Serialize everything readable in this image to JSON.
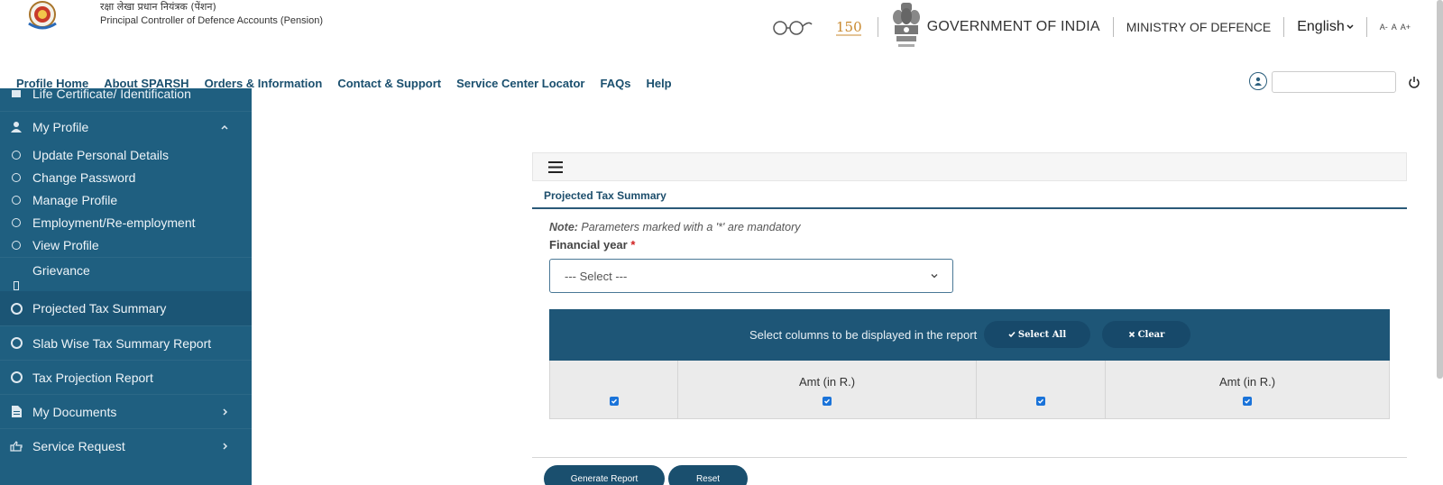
{
  "header": {
    "org_hindi": "रक्षा लेखा प्रधान नियंत्रक (पेंशन)",
    "org_name": "Principal Controller of Defence Accounts (Pension)",
    "gov": "GOVERNMENT OF INDIA",
    "ministry": "MINISTRY OF DEFENCE",
    "language": "English",
    "font_sizes": [
      "A-",
      "A",
      "A+"
    ]
  },
  "nav": {
    "items": [
      "Profile Home",
      "About SPARSH",
      "Orders & Information",
      "Contact & Support",
      "Service Center Locator",
      "FAQs",
      "Help"
    ]
  },
  "sidebar": {
    "life_certificate": "Life Certificate/ Identification",
    "my_profile": "My Profile",
    "profile_items": [
      "Update Personal Details",
      "Change Password",
      "Manage Profile",
      "Employment/Re-employment",
      "View Profile"
    ],
    "grievance": "Grievance",
    "projected_tax": "Projected Tax Summary",
    "slab_wise": "Slab Wise Tax Summary Report",
    "tax_projection": "Tax Projection Report",
    "my_documents": "My Documents",
    "service_request": "Service Request"
  },
  "main": {
    "title": "Projected Tax Summary",
    "note_label": "Note:",
    "note_text": " Parameters marked with a '*' are mandatory",
    "fy_label": "Financial year",
    "fy_required": "*",
    "fy_select": "--- Select ---",
    "columns_prompt": "Select columns to be displayed in the report",
    "select_all": "Select All",
    "clear": "Clear",
    "col_headers": [
      "",
      "Amt (in R.)",
      "",
      "Amt (in R.)"
    ],
    "generate": "Generate Report",
    "reset": "Reset"
  },
  "colors": {
    "sidebar": "#1f5f80",
    "accent": "#1a4f6e",
    "checkbox": "#1a73d9"
  }
}
